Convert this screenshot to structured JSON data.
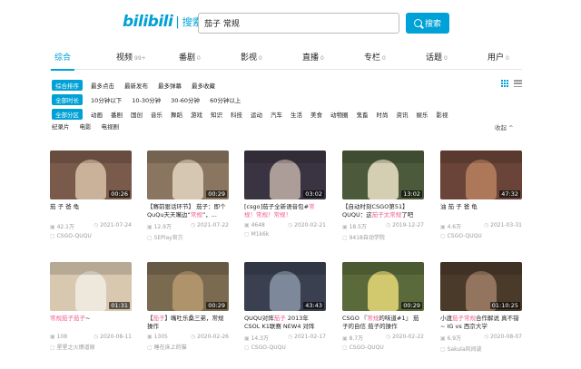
{
  "header": {
    "logo_text": "bilibili",
    "logo_sep": "|",
    "logo_sub": "搜索",
    "search_value": "茄子 常规",
    "search_button": "搜索"
  },
  "tabs": [
    {
      "label": "综合",
      "count": ""
    },
    {
      "label": "视频",
      "count": "99+"
    },
    {
      "label": "番剧",
      "count": "0"
    },
    {
      "label": "影视",
      "count": "0"
    },
    {
      "label": "直播",
      "count": "0"
    },
    {
      "label": "专栏",
      "count": "0"
    },
    {
      "label": "话题",
      "count": "0"
    },
    {
      "label": "用户",
      "count": "0"
    }
  ],
  "filters": {
    "sort": {
      "chip": "综合排序",
      "options": [
        "最多点击",
        "最新发布",
        "最多弹幕",
        "最多收藏"
      ]
    },
    "duration": {
      "chip": "全部时长",
      "options": [
        "10分钟以下",
        "10-30分钟",
        "30-60分钟",
        "60分钟以上"
      ]
    },
    "zone": {
      "chip": "全部分区",
      "options": [
        "动画",
        "番剧",
        "国创",
        "音乐",
        "舞蹈",
        "游戏",
        "知识",
        "科技",
        "运动",
        "汽车",
        "生活",
        "美食",
        "动物圈",
        "鬼畜",
        "时尚",
        "资讯",
        "娱乐",
        "影视"
      ]
    },
    "zone2": [
      "纪录片",
      "电影",
      "电视剧"
    ],
    "collapse": "收起 ^"
  },
  "videos": [
    {
      "duration": "00:26",
      "title_pre": "茄 子 爸 龟",
      "title_hl": "",
      "title_post": "",
      "views": "42.1万",
      "date": "2021-07-24",
      "uploader": "CSGO-QUQU",
      "bg": "#7a5a4a",
      "accent": "#d8c2a8"
    },
    {
      "duration": "00:29",
      "title_pre": "【赛前狠话环节】 茄子：即个QuQu天天嘴边“",
      "title_hl": "常规",
      "title_post": "”，...",
      "views": "12.9万",
      "date": "2021-07-22",
      "uploader": "5EPlay官方",
      "bg": "#8a7560",
      "accent": "#e2d6c0"
    },
    {
      "duration": "03:02",
      "title_pre": "[csgo]茄子全新语音包#",
      "title_hl": "常规！常规！常规！",
      "title_post": "",
      "views": "4648",
      "date": "2020-02-21",
      "uploader": "M1k6k",
      "bg": "#3a3442",
      "accent": "#c2b0a8"
    },
    {
      "duration": "13:02",
      "title_pre": "【自动时刻CSGO第51】 QUQU：这",
      "title_hl": "茄子太常规",
      "title_post": "了吧",
      "views": "18.5万",
      "date": "2019-12-27",
      "uploader": "9418自动学院",
      "bg": "#4a5a3a",
      "accent": "#ece4c8"
    },
    {
      "duration": "47:32",
      "title_pre": "油 茄 子 爸 龟",
      "title_hl": "",
      "title_post": "",
      "views": "4.6万",
      "date": "2021-03-31",
      "uploader": "CSGO-QUQU",
      "bg": "#6a4438",
      "accent": "#b88060"
    },
    {
      "duration": "01:31",
      "title_pre": "",
      "title_hl": "常规茄子茄子",
      "title_post": "~",
      "views": "108",
      "date": "2020-08-11",
      "uploader": "星星之火燎道原",
      "bg": "#d8c8b0",
      "accent": "#f2ece4"
    },
    {
      "duration": "00:29",
      "title_pre": "【",
      "title_hl": "茄子",
      "title_post": "】嘴吐乐桑三弟，常规操作",
      "views": "1305",
      "date": "2020-02-26",
      "uploader": "睡在床上的猫",
      "bg": "#7a6a50",
      "accent": "#b89a70"
    },
    {
      "duration": "43:43",
      "title_pre": "QUQU对阵",
      "title_hl": "茄子",
      "title_post": " 2013年 CSOL K1联赛 NEW4 对阵",
      "views": "14.3万",
      "date": "2021-02-17",
      "uploader": "CSGO-QUQU",
      "bg": "#3a4050",
      "accent": "#8a96a8"
    },
    {
      "duration": "00:29",
      "title_pre": "CSGO 『",
      "title_hl": "常规",
      "title_post": "的味道#1』 茄子的自信 茄子的操作",
      "views": "8.7万",
      "date": "2020-02-22",
      "uploader": "CSGO-QUQU",
      "bg": "#5a6a3a",
      "accent": "#e8d878"
    },
    {
      "duration": "01:10:25",
      "title_pre": "小渡",
      "title_hl": "茄子常规",
      "title_post": "合作解说 真不错~ IG vs 西京大学",
      "views": "6.9万",
      "date": "2020-08-07",
      "uploader": "Sakula风间波",
      "bg": "#4a3a2a",
      "accent": "#a08068"
    }
  ]
}
